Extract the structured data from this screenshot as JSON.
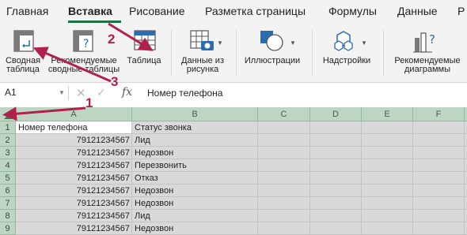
{
  "tabs": [
    {
      "label": "Главная"
    },
    {
      "label": "Вставка"
    },
    {
      "label": "Рисование"
    },
    {
      "label": "Разметка страницы"
    },
    {
      "label": "Формулы"
    },
    {
      "label": "Данные"
    },
    {
      "label": "Р"
    }
  ],
  "active_tab": "Вставка",
  "ribbon": {
    "pivot": "Сводная\nтаблица",
    "recommended_pivot": "Рекомендуемые\nсводные таблицы",
    "table": "Таблица",
    "picture": "Данные из\nрисунка",
    "illustrations": "Иллюстрации",
    "addins": "Надстройки",
    "recommended_charts": "Рекомендуемые\nдиаграммы"
  },
  "formula_bar": {
    "name_box": "A1",
    "fx": "fx",
    "value": "Номер телефона"
  },
  "columns": [
    "A",
    "B",
    "C",
    "D",
    "E",
    "F"
  ],
  "rows": [
    {
      "n": "1",
      "a": "Номер телефона",
      "b": "Статус звонка"
    },
    {
      "n": "2",
      "a": "79121234567",
      "b": "Лид"
    },
    {
      "n": "3",
      "a": "79121234567",
      "b": "Недозвон"
    },
    {
      "n": "4",
      "a": "79121234567",
      "b": "Перезвонить"
    },
    {
      "n": "5",
      "a": "79121234567",
      "b": "Отказ"
    },
    {
      "n": "6",
      "a": "79121234567",
      "b": "Недозвон"
    },
    {
      "n": "7",
      "a": "79121234567",
      "b": "Недозвон"
    },
    {
      "n": "8",
      "a": "79121234567",
      "b": "Лид"
    },
    {
      "n": "9",
      "a": "79121234567",
      "b": "Недозвон"
    }
  ],
  "annotations": [
    "1",
    "2",
    "3"
  ],
  "colors": {
    "accent": "#1f7244",
    "annotation": "#b0214e",
    "selection": "#d9d9d9",
    "header": "#bcd6c3"
  }
}
